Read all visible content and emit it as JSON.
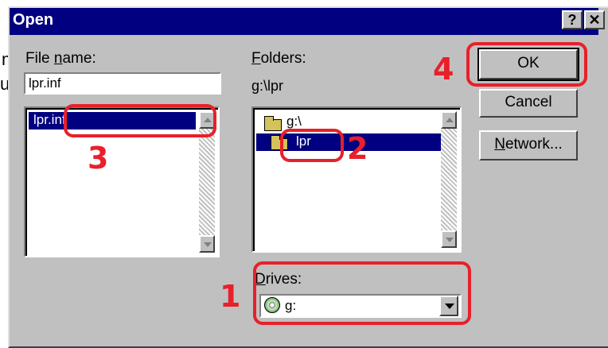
{
  "background": {
    "fragment1": "m",
    "fragment2": "u."
  },
  "dialog": {
    "title": "Open",
    "help_button": "?",
    "close_button": "✕"
  },
  "file_name": {
    "label_prefix": "File ",
    "label_underlined": "n",
    "label_suffix": "ame:",
    "value": "lpr.inf"
  },
  "files_list": {
    "items": [
      "lpr.inf"
    ]
  },
  "folders": {
    "label_underlined": "F",
    "label_suffix": "olders:",
    "current_path": "g:\\lpr",
    "items": [
      {
        "name": "g:\\",
        "icon": "open-folder-icon"
      },
      {
        "name": "lpr",
        "icon": "open-folder-icon",
        "selected": true
      }
    ]
  },
  "drives": {
    "label_underlined": "D",
    "label_suffix": "rives:",
    "value": "g:",
    "icon": "cd-drive-icon"
  },
  "buttons": {
    "ok": "OK",
    "cancel": "Cancel",
    "network_underlined": "N",
    "network_suffix": "etwork..."
  },
  "annotations": {
    "step1": "1",
    "step2": "2",
    "step3": "3",
    "step4": "4",
    "color": "#e8202a"
  }
}
